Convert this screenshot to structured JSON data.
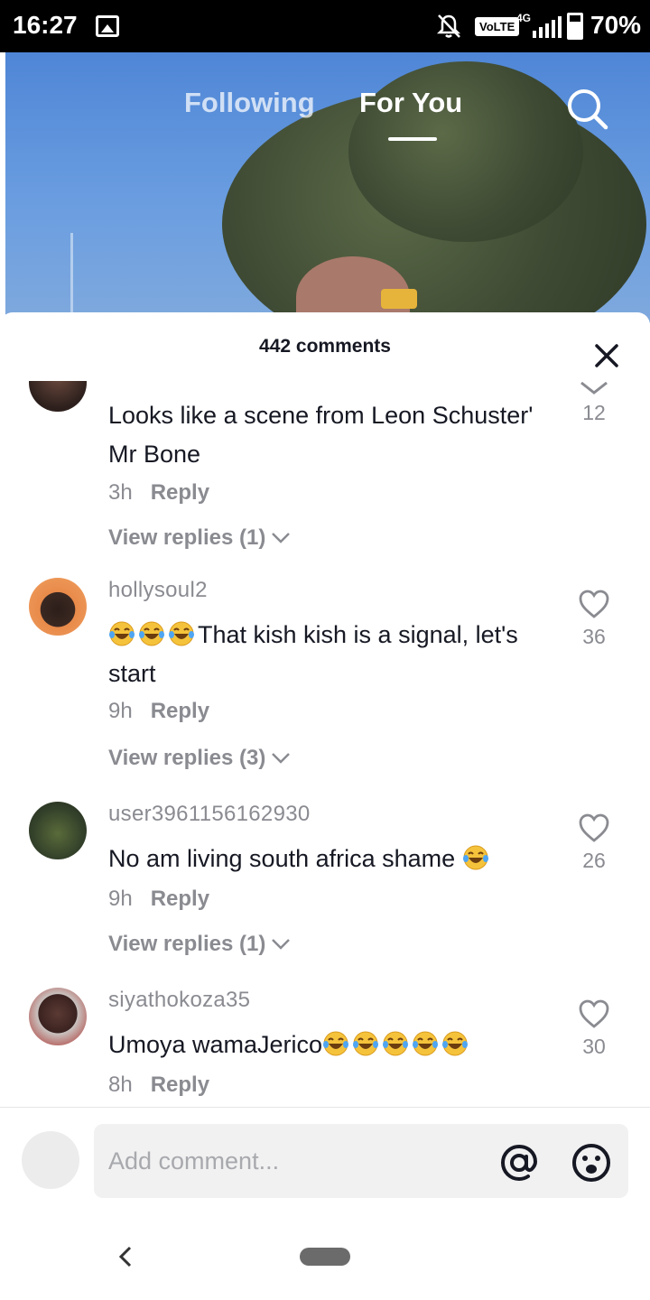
{
  "status_bar": {
    "time": "16:27",
    "volte": "VoLTE",
    "network": "4G",
    "battery": "70%",
    "icons": [
      "gallery-icon",
      "mute-icon",
      "signal-icon",
      "battery-icon"
    ]
  },
  "top_tabs": {
    "following": "Following",
    "for_you": "For You",
    "active": "For You"
  },
  "sheet": {
    "title": "442 comments"
  },
  "comments": [
    {
      "username": "",
      "text": "Looks like a scene from Leon Schuster' Mr Bone",
      "emoji_prefix": 0,
      "emoji_suffix": 0,
      "time": "3h",
      "reply_label": "Reply",
      "view_replies": "View replies (1)",
      "likes": "12",
      "liked_icon": "chevron-down-icon"
    },
    {
      "username": "hollysoul2",
      "text": "That kish kish is a signal, let's start",
      "emoji_prefix": 3,
      "emoji_suffix": 0,
      "time": "9h",
      "reply_label": "Reply",
      "view_replies": "View replies (3)",
      "likes": "36"
    },
    {
      "username": "user3961156162930",
      "text": "No am living south africa shame ",
      "emoji_prefix": 0,
      "emoji_suffix": 1,
      "time": "9h",
      "reply_label": "Reply",
      "view_replies": "View replies (1)",
      "likes": "26"
    },
    {
      "username": "siyathokoza35",
      "text": "Umoya wamaJerico",
      "emoji_prefix": 0,
      "emoji_suffix": 5,
      "time": "8h",
      "reply_label": "Reply",
      "view_replies": "",
      "likes": "30"
    }
  ],
  "composer": {
    "placeholder": "Add comment..."
  },
  "colors": {
    "text_primary": "#161823",
    "text_secondary": "#8a8b91",
    "input_bg": "#f1f1f2"
  }
}
